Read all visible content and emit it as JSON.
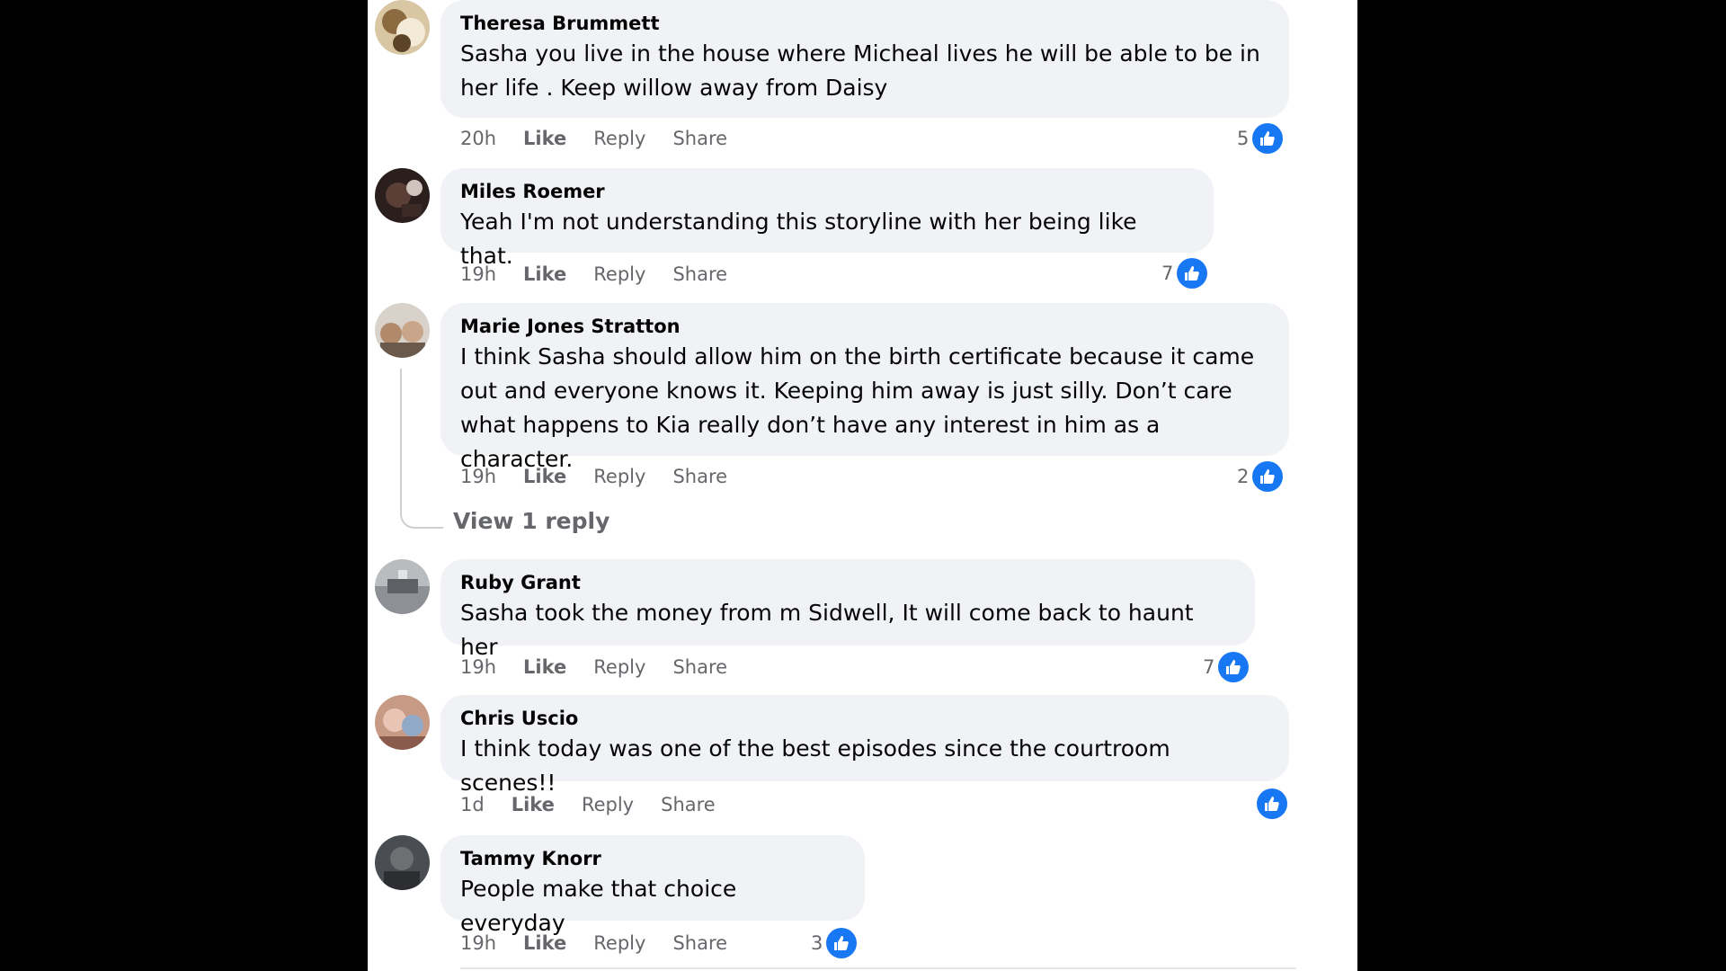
{
  "colors": {
    "background": "#000000",
    "panel": "#ffffff",
    "bubble": "#f0f2f5",
    "text": "#050505",
    "meta": "#65676b",
    "like_blue": "#1877f2"
  },
  "comments": [
    {
      "author": "Theresa Brummett",
      "text": "Sasha you live in the house where Micheal lives he will be able to be in her life . Keep willow away from Daisy",
      "time": "20h",
      "like": "Like",
      "reply": "Reply",
      "share": "Share",
      "reactions": "5",
      "reaction_icon": "thumbs-up-icon"
    },
    {
      "author": "Miles Roemer",
      "text": "Yeah I'm not understanding this storyline with her being like that.",
      "time": "19h",
      "like": "Like",
      "reply": "Reply",
      "share": "Share",
      "reactions": "7",
      "reaction_icon": "thumbs-up-icon"
    },
    {
      "author": "Marie Jones Stratton",
      "text": "I think Sasha should allow him on the birth certificate because it came out and everyone knows it. Keeping him away is just silly. Don’t care what happens to Kia really don’t have any interest in him as a character.",
      "time": "19h",
      "like": "Like",
      "reply": "Reply",
      "share": "Share",
      "reactions": "2",
      "reaction_icon": "thumbs-up-icon",
      "view_replies": "View 1 reply"
    },
    {
      "author": "Ruby Grant",
      "text": "Sasha took the money from m Sidwell, It will come back to haunt her",
      "time": "19h",
      "like": "Like",
      "reply": "Reply",
      "share": "Share",
      "reactions": "7",
      "reaction_icon": "thumbs-up-icon"
    },
    {
      "author": "Chris Uscio",
      "text": "I think today was one of the best episodes since the courtroom scenes!!",
      "time": "1d",
      "like": "Like",
      "reply": "Reply",
      "share": "Share",
      "reactions": "",
      "reaction_icon": "thumbs-up-icon"
    },
    {
      "author": "Tammy Knorr",
      "text": "People make that choice everyday",
      "time": "19h",
      "like": "Like",
      "reply": "Reply",
      "share": "Share",
      "reactions": "3",
      "reaction_icon": "thumbs-up-icon"
    }
  ]
}
